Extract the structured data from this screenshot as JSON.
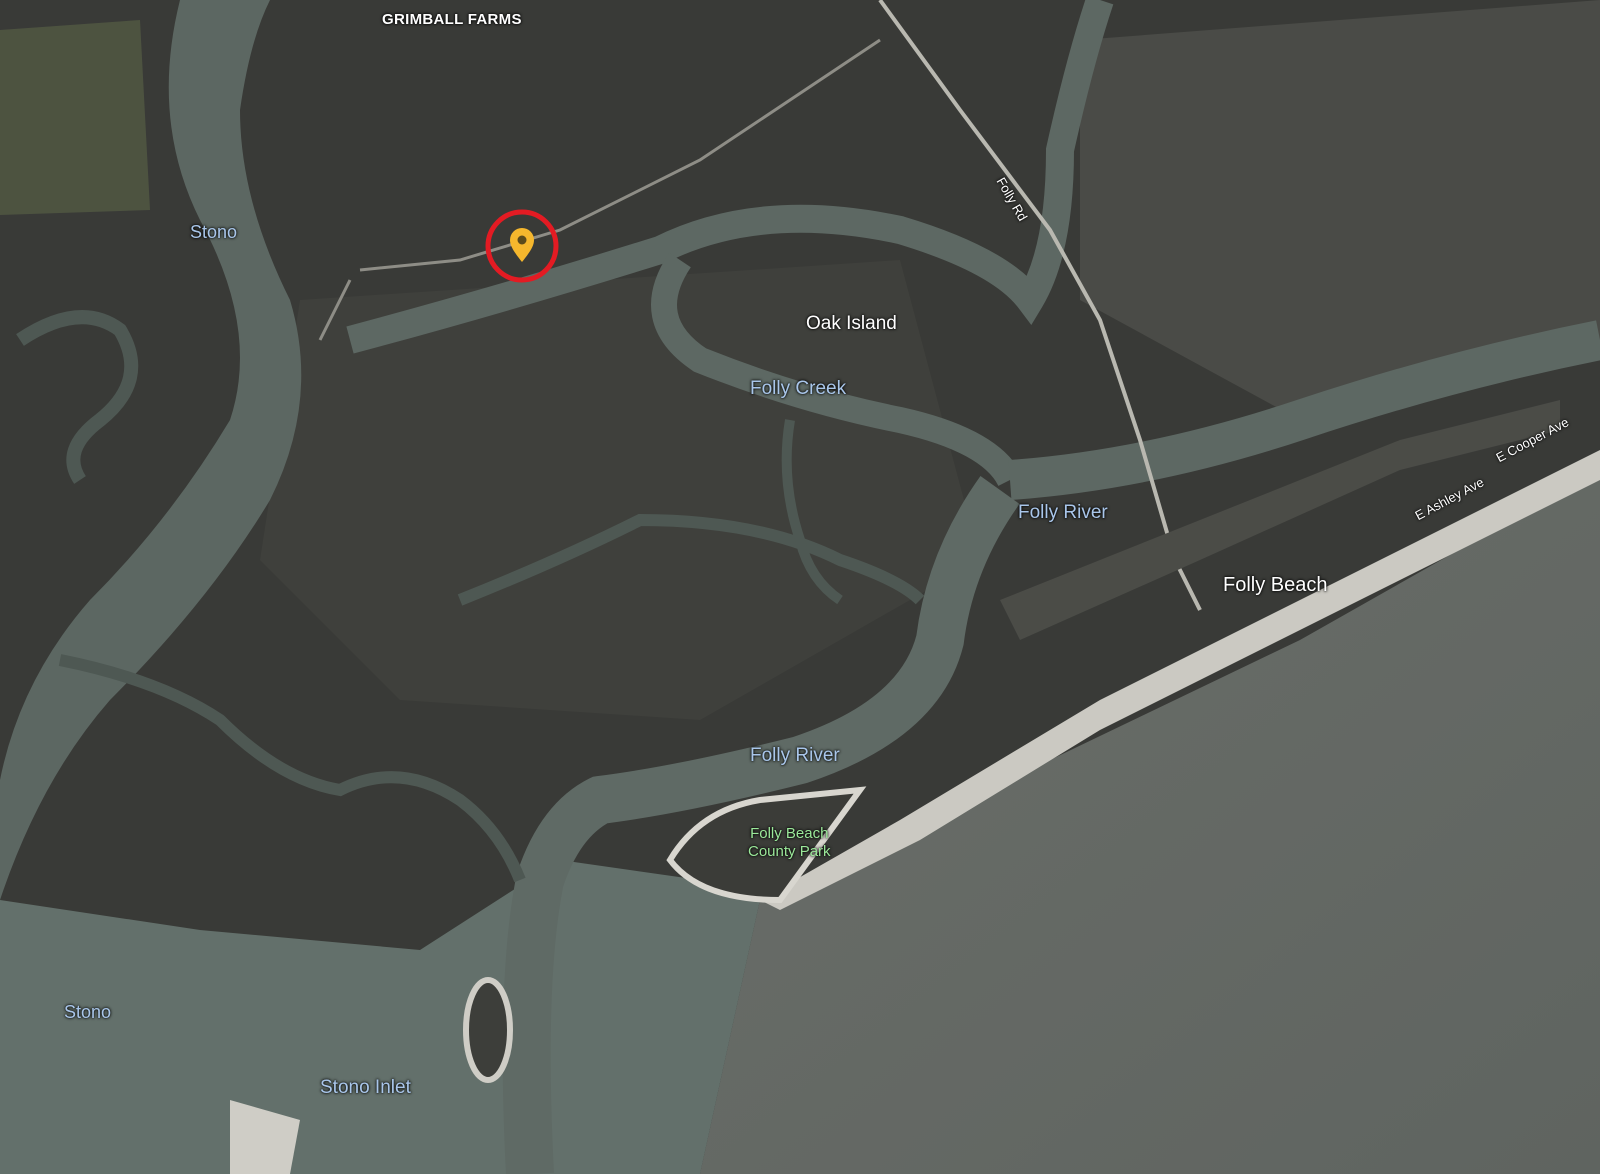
{
  "map": {
    "type": "satellite",
    "colors": {
      "land": "#3a3a36",
      "marsh": "#494944",
      "water": "#5b6661",
      "ocean": "#6b6f6a",
      "beach": "#cfcdc6",
      "road": "#bdbdb5",
      "label_water": "#a9c6ea",
      "label_place": "#ffffff",
      "label_park": "#9be89a",
      "pin": "#f5b72d",
      "highlight_circle": "#e31b23"
    },
    "labels": {
      "district": "GRIMBALL FARMS",
      "stono_north": "Stono",
      "oak_island": "Oak Island",
      "folly_creek": "Folly Creek",
      "folly_rd": "Folly Rd",
      "folly_river_upper": "Folly River",
      "folly_river_lower": "Folly River",
      "folly_beach": "Folly Beach",
      "e_ashley_ave": "E Ashley Ave",
      "e_cooper_ave": "E Cooper Ave",
      "park_line1": "Folly Beach",
      "park_line2": "County Park",
      "stono_south": "Stono",
      "stono_inlet": "Stono Inlet"
    },
    "marker": {
      "icon": "map-pin-icon",
      "highlight": "red-circle-icon"
    }
  }
}
